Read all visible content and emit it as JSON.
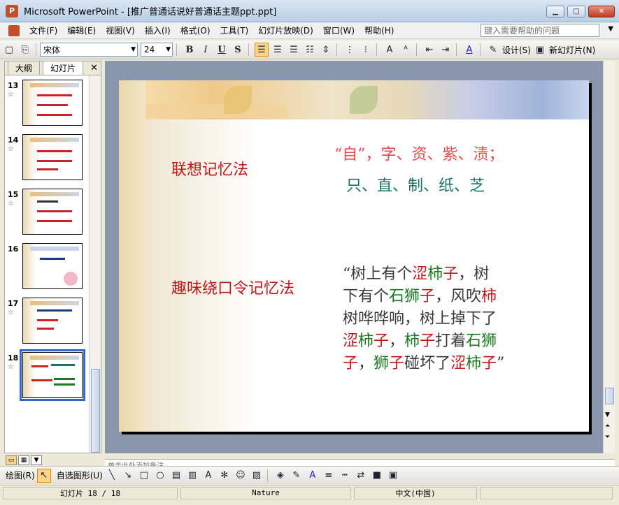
{
  "window": {
    "title": "Microsoft PowerPoint - [推广普通话说好普通话主题ppt.ppt]",
    "app_icon": "powerpoint-icon"
  },
  "menubar": {
    "items": [
      "文件(F)",
      "编辑(E)",
      "视图(V)",
      "插入(I)",
      "格式(O)",
      "工具(T)",
      "幻灯片放映(D)",
      "窗口(W)",
      "帮助(H)"
    ],
    "help_placeholder": "键入需要帮助的问题"
  },
  "toolbar": {
    "font_name": "宋体",
    "font_size": "24",
    "bold": "B",
    "italic": "I",
    "underline": "U",
    "shadow": "S",
    "design_label": "设计(S)",
    "new_slide_label": "新幻灯片(N)"
  },
  "outline_pane": {
    "tabs": [
      "大纲",
      "幻灯片"
    ],
    "active_tab": "幻灯片",
    "thumbnails": [
      {
        "number": "13"
      },
      {
        "number": "14"
      },
      {
        "number": "15"
      },
      {
        "number": "16"
      },
      {
        "number": "17"
      },
      {
        "number": "18",
        "selected": true
      }
    ]
  },
  "slide": {
    "heading1": "联想记忆法",
    "heading2": "趣味绕口令记忆法",
    "line1": "“自”，字、资、紫、渍；",
    "line2": "只、直、制、纸、芝",
    "poem": [
      [
        {
          "t": "“树上有个",
          "c": "dark"
        },
        {
          "t": "涩",
          "c": "red"
        },
        {
          "t": "柿",
          "c": "green"
        },
        {
          "t": "子",
          "c": "red"
        },
        {
          "t": "，树",
          "c": "dark"
        }
      ],
      [
        {
          "t": "下有个",
          "c": "dark"
        },
        {
          "t": "石",
          "c": "green"
        },
        {
          "t": "狮",
          "c": "green"
        },
        {
          "t": "子",
          "c": "red"
        },
        {
          "t": "，风吹",
          "c": "dark"
        },
        {
          "t": "柿",
          "c": "red"
        }
      ],
      [
        {
          "t": "树哗哗响，树上掉下了",
          "c": "dark"
        }
      ],
      [
        {
          "t": "涩",
          "c": "red"
        },
        {
          "t": "柿",
          "c": "green"
        },
        {
          "t": "子",
          "c": "red"
        },
        {
          "t": "，",
          "c": "dark"
        },
        {
          "t": "柿",
          "c": "green"
        },
        {
          "t": "子",
          "c": "red"
        },
        {
          "t": "打着",
          "c": "dark"
        },
        {
          "t": "石",
          "c": "green"
        },
        {
          "t": "狮",
          "c": "green"
        }
      ],
      [
        {
          "t": "子",
          "c": "red"
        },
        {
          "t": "，",
          "c": "dark"
        },
        {
          "t": "狮",
          "c": "green"
        },
        {
          "t": "子",
          "c": "red"
        },
        {
          "t": "碰坏了",
          "c": "dark"
        },
        {
          "t": "涩",
          "c": "red"
        },
        {
          "t": "柿",
          "c": "green"
        },
        {
          "t": "子",
          "c": "red"
        },
        {
          "t": "”",
          "c": "dark"
        }
      ]
    ]
  },
  "notes": {
    "placeholder": "单击此处添加备注"
  },
  "drawbar": {
    "draw_label": "绘图(R)",
    "autoshapes_label": "自选图形(U)"
  },
  "status": {
    "slide_indicator": "幻灯片 18 / 18",
    "design_template": "Nature",
    "language": "中文(中国)"
  },
  "colors": {
    "heading_red": "#c0171b",
    "green": "#1a7a1f",
    "teal": "#1a7063"
  }
}
